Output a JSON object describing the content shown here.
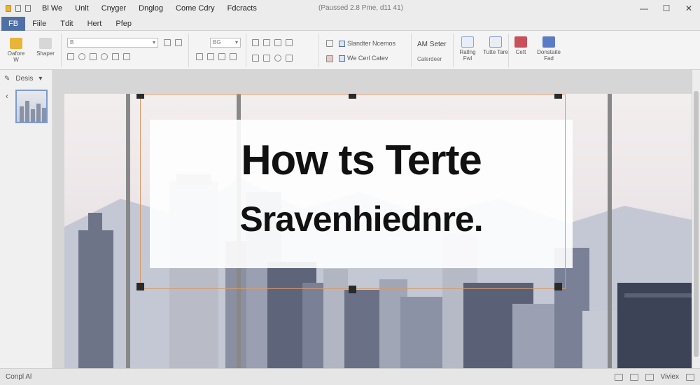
{
  "titlebar": {
    "menus": [
      "Bl We",
      "Unlt",
      "Cnyger",
      "Dnglog",
      "Come Cdry",
      "Fdcracts"
    ],
    "document_title": "(Paussed 2.8 Pme, d11 41)",
    "controls": [
      "—",
      "☐",
      "✕"
    ]
  },
  "tabs": [
    "FB",
    "Fiile",
    "Tdit",
    "Hert",
    "Pfep"
  ],
  "ribbon": {
    "clipboard": {
      "paste_label": "Oafore  W",
      "format_label": "Shaper"
    },
    "font": {
      "font_name": "B",
      "font_size": "BG"
    },
    "style_checks": [
      "Slandter Ncemos",
      "We Cerl Catev"
    ],
    "select": {
      "label": "AM Seter",
      "sub_label": "Calerdeer"
    },
    "buttons": [
      {
        "label": "Ratlng Fwl",
        "color": "#e7eef8"
      },
      {
        "label": "Tutte Tare",
        "color": "#e9eef6"
      },
      {
        "label": "Cett",
        "color": "#c94f5a"
      },
      {
        "label": "Donstaite Fad",
        "color": "#5b7bc4"
      }
    ]
  },
  "pane": {
    "label": "Desis"
  },
  "slide": {
    "headline": "How ts Terte",
    "subline": "Sravenhiednre."
  },
  "status": {
    "left": "Conpl Al",
    "right": "Viviex"
  },
  "colors": {
    "accent": "#4f6fa8",
    "selection_border": "#d69a6a"
  }
}
